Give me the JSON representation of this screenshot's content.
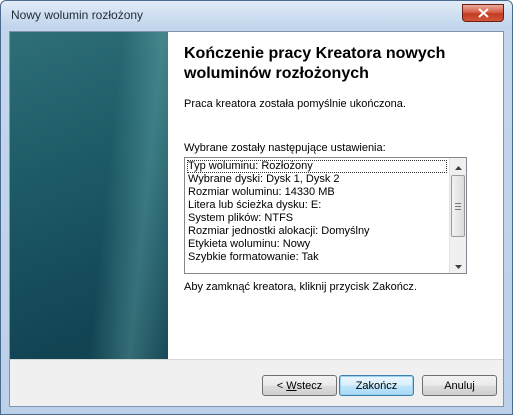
{
  "window": {
    "title": "Nowy wolumin rozłożony"
  },
  "page": {
    "heading_line1": "Kończenie pracy Kreatora nowych",
    "heading_line2": "woluminów rozłożonych",
    "success_text": "Praca kreatora została pomyślnie ukończona.",
    "settings_label": "Wybrane zostały następujące ustawienia:",
    "settings": [
      "Typ woluminu: Rozłożony",
      "Wybrane dyski: Dysk 1, Dysk 2",
      "Rozmiar woluminu: 14330 MB",
      "Litera lub ścieżka dysku: E:",
      "System plików: NTFS",
      "Rozmiar jednostki alokacji: Domyślny",
      "Etykieta woluminu: Nowy",
      "Szybkie formatowanie: Tak"
    ],
    "close_hint": "Aby zamknąć kreatora, kliknij przycisk Zakończ."
  },
  "buttons": {
    "back_prefix": "< ",
    "back_accel": "W",
    "back_rest": "stecz",
    "finish": "Zakończ",
    "cancel": "Anuluj"
  },
  "icons": {
    "close": "close-icon",
    "scroll_up": "arrow-up-icon",
    "scroll_down": "arrow-down-icon"
  },
  "colors": {
    "close_button": "#c23b21",
    "banner": "#1f5d68"
  }
}
